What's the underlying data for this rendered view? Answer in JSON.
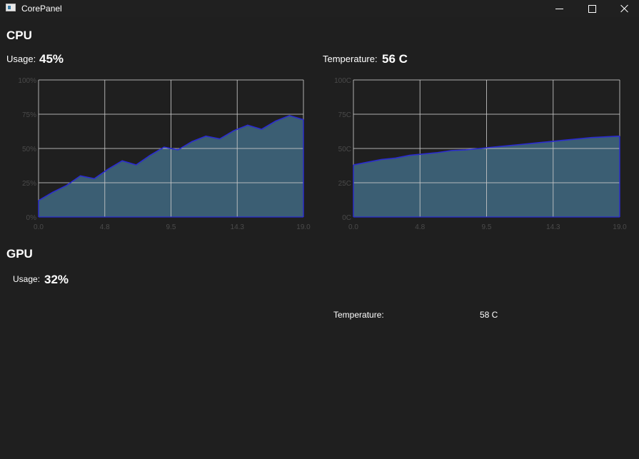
{
  "window": {
    "title": "CorePanel",
    "icon": "app-icon"
  },
  "controls": {
    "minimize": "minimize-icon",
    "maximize": "maximize-icon",
    "close": "close-icon"
  },
  "cpu": {
    "title": "CPU",
    "usage_label": "Usage:",
    "usage_value": "45%",
    "temp_label": "Temperature:",
    "temp_value": "56 C"
  },
  "gpu": {
    "title": "GPU",
    "usage_label": "Usage:",
    "usage_value": "32%",
    "temp_label": "Temperature:",
    "temp_value": "58 C"
  },
  "colors": {
    "background": "#1f1f1f",
    "area_fill": "#3b5e73",
    "area_stroke": "#2b2bd0",
    "grid": "#c8c8c8",
    "tick_text": "#4a4a4a"
  },
  "chart_data": [
    {
      "type": "area",
      "x": [
        0,
        1,
        2,
        3,
        4,
        5,
        6,
        7,
        8,
        9,
        10,
        11,
        12,
        13,
        14,
        15,
        16,
        17,
        18,
        19
      ],
      "series": [
        {
          "values": [
            12,
            18,
            23,
            30,
            28,
            35,
            41,
            38,
            45,
            51,
            49,
            55,
            59,
            57,
            63,
            67,
            64,
            70,
            74,
            71
          ]
        }
      ],
      "xticks": [
        "0.0",
        "4.8",
        "9.5",
        "14.3",
        "19.0"
      ],
      "yticks": [
        "0%",
        "25%",
        "50%",
        "75%",
        "100%"
      ],
      "xlim": [
        0,
        19
      ],
      "ylim": [
        0,
        100
      ],
      "grid": true,
      "title": "",
      "xlabel": "",
      "ylabel": ""
    },
    {
      "type": "area",
      "x": [
        0,
        1,
        2,
        3,
        4,
        5,
        6,
        7,
        8,
        9,
        10,
        11,
        12,
        13,
        14,
        15,
        16,
        17,
        18,
        19
      ],
      "series": [
        {
          "values": [
            38,
            40,
            42,
            43,
            45,
            46,
            47,
            48.5,
            49,
            50,
            51,
            52,
            53,
            54,
            55,
            56,
            57,
            58,
            58.5,
            59
          ]
        }
      ],
      "xticks": [
        "0.0",
        "4.8",
        "9.5",
        "14.3",
        "19.0"
      ],
      "yticks": [
        "0C",
        "25C",
        "50C",
        "75C",
        "100C"
      ],
      "xlim": [
        0,
        19
      ],
      "ylim": [
        0,
        100
      ],
      "grid": true,
      "title": "",
      "xlabel": "",
      "ylabel": ""
    }
  ]
}
